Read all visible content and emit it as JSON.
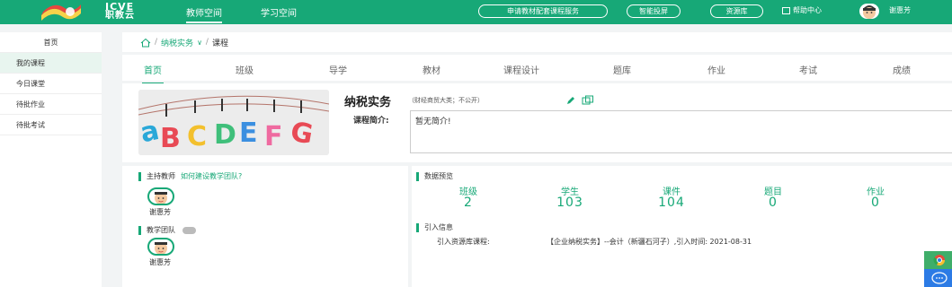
{
  "brand": {
    "line1": "ICVE",
    "line2": "职教云"
  },
  "nav": {
    "teacher_space": "教师空间",
    "study_space": "学习空间"
  },
  "top_actions": {
    "apply_service": "申请教材配套课程服务",
    "smart_cast": "智能投屏",
    "resource_lib": "资源库",
    "help_center": "帮助中心"
  },
  "user": {
    "name": "谢惠芳"
  },
  "sidebar": {
    "items": [
      {
        "label": "首页"
      },
      {
        "label": "我的课程"
      },
      {
        "label": "今日课堂"
      },
      {
        "label": "待批作业"
      },
      {
        "label": "待批考试"
      }
    ]
  },
  "breadcrumb": {
    "course_name": "纳税实务",
    "chevron": "∨",
    "current": "课程",
    "sep": "/"
  },
  "tabs": [
    {
      "label": "首页"
    },
    {
      "label": "班级"
    },
    {
      "label": "导学"
    },
    {
      "label": "教材"
    },
    {
      "label": "课程设计"
    },
    {
      "label": "题库"
    },
    {
      "label": "作业"
    },
    {
      "label": "考试"
    },
    {
      "label": "成绩"
    }
  ],
  "course": {
    "title": "纳税实务",
    "meta": "（财经商贸大类；不公开）",
    "intro_label": "课程简介:",
    "intro_text": "暂无简介!"
  },
  "teachers": {
    "main_label": "主持教师",
    "build_link": "如何建设教学团队?",
    "main_name": "谢惠芳",
    "team_label": "教学团队",
    "team_name": "谢惠芳"
  },
  "overview": {
    "title": "数据预览",
    "stats": [
      {
        "label": "班级",
        "value": "2"
      },
      {
        "label": "学生",
        "value": "103"
      },
      {
        "label": "课件",
        "value": "104"
      },
      {
        "label": "题目",
        "value": "0"
      },
      {
        "label": "作业",
        "value": "0"
      }
    ],
    "import_title": "引入信息",
    "import_label": "引入资源库课程:",
    "import_value": "【企业纳税实务】--会计（新疆石河子）,引入时间: 2021-08-31"
  },
  "colors": {
    "accent": "#17a877",
    "background": "#f2f4f5"
  }
}
